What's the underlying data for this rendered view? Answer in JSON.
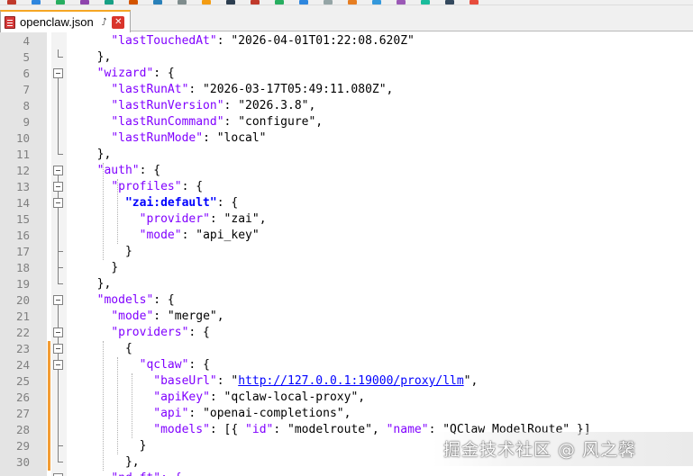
{
  "tab": {
    "filename": "openclaw.json",
    "pin_glyph": "⭜",
    "close_glyph": "✕"
  },
  "toolbar_icon_colors": [
    "#c0392b",
    "#2e86de",
    "#27ae60",
    "#8e44ad",
    "#16a085",
    "#d35400",
    "#2980b9",
    "#7f8c8d",
    "#f39c12",
    "#2c3e50",
    "#c0392b",
    "#27ae60",
    "#2e86de",
    "#95a5a6",
    "#e67e22",
    "#3498db",
    "#9b59b6",
    "#1abc9c",
    "#34495e",
    "#e74c3c"
  ],
  "colors": {
    "key": "#8000ff",
    "bold_key": "#0000ff",
    "link": "#0000ff",
    "change_bar": "#f39c33",
    "line_number": "#808080"
  },
  "lines": [
    {
      "n": "4",
      "indent": "    ",
      "key": "\"lastTouchedAt\"",
      "rest": ": \"2026-04-01T01:22:08.620Z\""
    },
    {
      "n": "5",
      "indent": "  ",
      "key": "",
      "rest": "},"
    },
    {
      "n": "6",
      "indent": "  ",
      "key": "\"wizard\"",
      "rest": ": {"
    },
    {
      "n": "7",
      "indent": "    ",
      "key": "\"lastRunAt\"",
      "rest": ": \"2026-03-17T05:49:11.080Z\","
    },
    {
      "n": "8",
      "indent": "    ",
      "key": "\"lastRunVersion\"",
      "rest": ": \"2026.3.8\","
    },
    {
      "n": "9",
      "indent": "    ",
      "key": "\"lastRunCommand\"",
      "rest": ": \"configure\","
    },
    {
      "n": "10",
      "indent": "    ",
      "key": "\"lastRunMode\"",
      "rest": ": \"local\""
    },
    {
      "n": "11",
      "indent": "  ",
      "key": "",
      "rest": "},"
    },
    {
      "n": "12",
      "indent": "  ",
      "key": "\"auth\"",
      "rest": ": {"
    },
    {
      "n": "13",
      "indent": "    ",
      "key": "\"profiles\"",
      "rest": ": {"
    },
    {
      "n": "14",
      "indent": "      ",
      "key": "\"zai:default\"",
      "rest": ": {",
      "bold": true
    },
    {
      "n": "15",
      "indent": "        ",
      "key": "\"provider\"",
      "rest": ": \"zai\","
    },
    {
      "n": "16",
      "indent": "        ",
      "key": "\"mode\"",
      "rest": ": \"api_key\""
    },
    {
      "n": "17",
      "indent": "      ",
      "key": "",
      "rest": "}"
    },
    {
      "n": "18",
      "indent": "    ",
      "key": "",
      "rest": "}"
    },
    {
      "n": "19",
      "indent": "  ",
      "key": "",
      "rest": "},"
    },
    {
      "n": "20",
      "indent": "  ",
      "key": "\"models\"",
      "rest": ": {"
    },
    {
      "n": "21",
      "indent": "    ",
      "key": "\"mode\"",
      "rest": ": \"merge\","
    },
    {
      "n": "22",
      "indent": "    ",
      "key": "\"providers\"",
      "rest": ": {"
    },
    {
      "n": "23",
      "indent": "      ",
      "key": "",
      "rest": "{"
    },
    {
      "n": "24",
      "indent": "",
      "key": "",
      "rest": ""
    },
    {
      "n": "25",
      "indent": "          ",
      "key": "\"baseUrl\"",
      "rest": ": "
    },
    {
      "n": "26",
      "indent": "          ",
      "key": "\"apiKey\"",
      "rest": ": \"qclaw-local-proxy\","
    },
    {
      "n": "27",
      "indent": "          ",
      "key": "\"api\"",
      "rest": ": \"openai-completions\","
    },
    {
      "n": "28",
      "indent": "          ",
      "key": "\"models\"",
      "rest": ": [{ "
    },
    {
      "n": "29",
      "indent": "        ",
      "key": "",
      "rest": "}"
    },
    {
      "n": "30",
      "indent": "      ",
      "key": "",
      "rest": "},"
    }
  ],
  "line24": {
    "key": "\"qclaw\"",
    "rest": ": {"
  },
  "line25": {
    "url": "http://127.0.0.1:19000/proxy/llm",
    "tail": "\",",
    "head": "\""
  },
  "line28": {
    "id_key": "\"id\"",
    "id_sep": ": \"modelroute\", ",
    "name_key": "\"name\"",
    "name_sep": ": \"QClaw ModelRoute\" }]"
  },
  "line31_partial": "\"nd_ft\": {",
  "watermark": "掘金技术社区 @ 风之馨"
}
